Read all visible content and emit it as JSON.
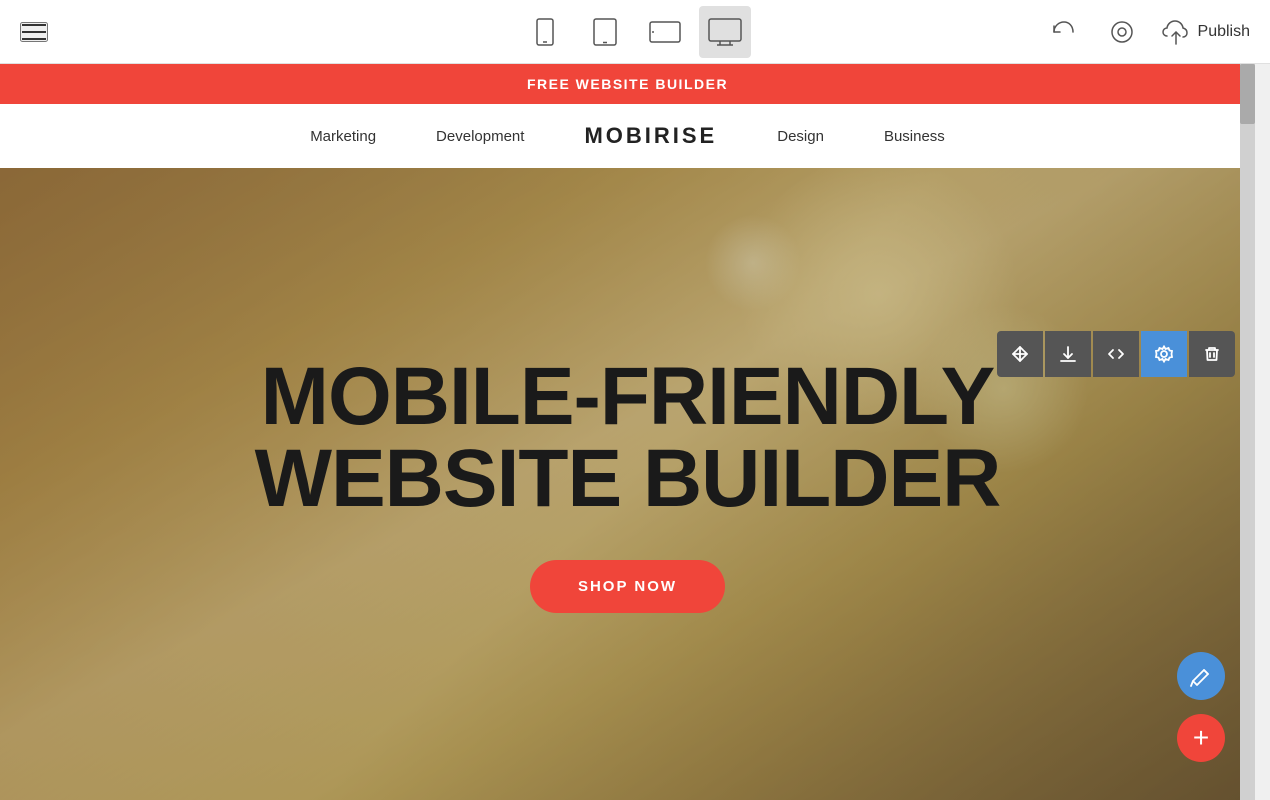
{
  "toolbar": {
    "publish_label": "Publish",
    "devices": [
      {
        "id": "mobile",
        "label": "Mobile view"
      },
      {
        "id": "tablet",
        "label": "Tablet view"
      },
      {
        "id": "tablet-landscape",
        "label": "Tablet landscape view"
      },
      {
        "id": "desktop",
        "label": "Desktop view"
      }
    ]
  },
  "banner": {
    "text": "FREE WEBSITE BUILDER"
  },
  "navbar": {
    "brand": "MOBIRISE",
    "links": [
      {
        "label": "Marketing"
      },
      {
        "label": "Development"
      },
      {
        "label": "Design"
      },
      {
        "label": "Business"
      }
    ]
  },
  "hero": {
    "title_line1": "MOBILE-FRIENDLY",
    "title_line2": "WEBSITE BUILDER",
    "cta_label": "SHOP NOW"
  },
  "section_toolbar": {
    "move_label": "Move",
    "download_label": "Download",
    "code_label": "Code",
    "settings_label": "Settings",
    "delete_label": "Delete"
  },
  "fab": {
    "edit_label": "Edit",
    "add_label": "Add block"
  }
}
